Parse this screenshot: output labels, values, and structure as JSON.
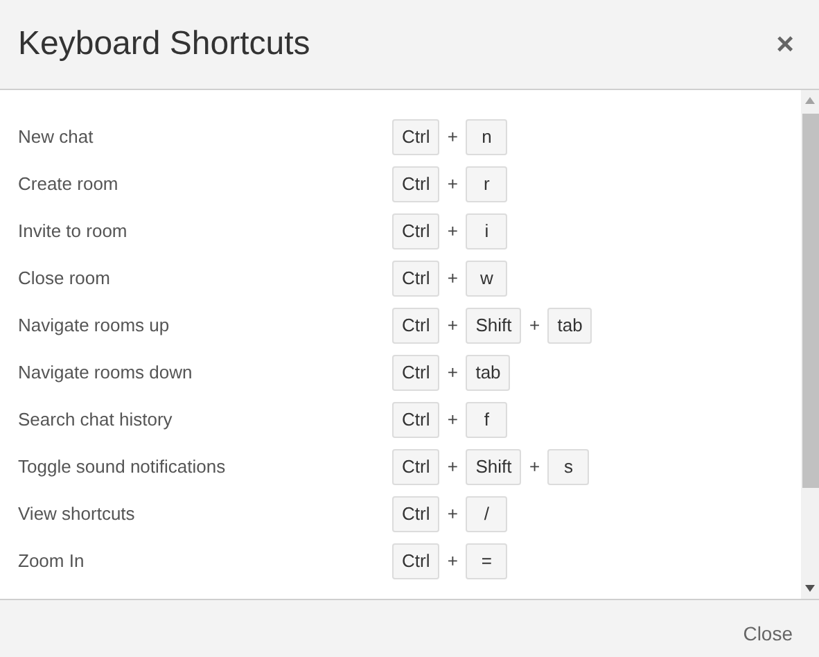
{
  "dialog": {
    "title": "Keyboard Shortcuts",
    "close_icon": "×"
  },
  "shortcuts": [
    {
      "action": "New chat",
      "keys": [
        "Ctrl",
        "n"
      ]
    },
    {
      "action": "Create room",
      "keys": [
        "Ctrl",
        "r"
      ]
    },
    {
      "action": "Invite to room",
      "keys": [
        "Ctrl",
        "i"
      ]
    },
    {
      "action": "Close room",
      "keys": [
        "Ctrl",
        "w"
      ]
    },
    {
      "action": "Navigate rooms up",
      "keys": [
        "Ctrl",
        "Shift",
        "tab"
      ]
    },
    {
      "action": "Navigate rooms down",
      "keys": [
        "Ctrl",
        "tab"
      ]
    },
    {
      "action": "Search chat history",
      "keys": [
        "Ctrl",
        "f"
      ]
    },
    {
      "action": "Toggle sound notifications",
      "keys": [
        "Ctrl",
        "Shift",
        "s"
      ]
    },
    {
      "action": "View shortcuts",
      "keys": [
        "Ctrl",
        "/"
      ]
    },
    {
      "action": "Zoom In",
      "keys": [
        "Ctrl",
        "="
      ]
    }
  ],
  "separator": "+",
  "footer": {
    "close_button": "Close"
  }
}
